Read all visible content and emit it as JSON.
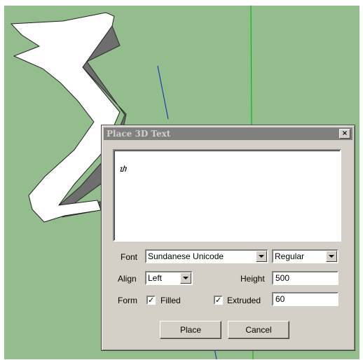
{
  "dialog": {
    "title": "Place 3D Text",
    "close_glyph": "×",
    "text_value": "ᮒ",
    "font_label": "Font",
    "font_value": "Sundanese Unicode",
    "style_value": "Regular",
    "align_label": "Align",
    "align_value": "Left",
    "height_label": "Height",
    "height_value": "500",
    "form_label": "Form",
    "filled_label": "Filled",
    "filled_checked": "✓",
    "extruded_label": "Extruded",
    "extruded_checked": "✓",
    "extrude_value": "60",
    "place_label": "Place",
    "cancel_label": "Cancel"
  },
  "colors": {
    "canvas_background": "#94bd8e",
    "green_axis": "#00b000",
    "blue_axis": "#1020c0",
    "glyph_face": "#ffffff",
    "glyph_side": "#6e6e6e"
  }
}
